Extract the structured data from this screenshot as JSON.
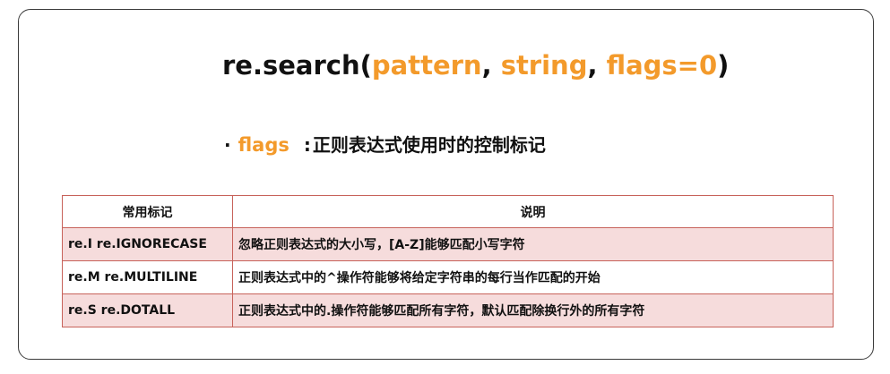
{
  "signature": {
    "func": "re.search",
    "open_paren": "(",
    "param1": "pattern",
    "comma1": ", ",
    "param2": "string",
    "comma2": ", ",
    "param3": "flags=0",
    "close_paren": ")"
  },
  "flags_line": {
    "bullet": "·",
    "keyword": "flags",
    "separator": ":",
    "description": "正则表达式使用时的控制标记"
  },
  "colors": {
    "accent": "#f39a2b",
    "row_shade": "#f6dcdc",
    "border": "#c7625a"
  },
  "table": {
    "headers": [
      "常用标记",
      "说明"
    ],
    "rows": [
      {
        "flag": "re.I  re.IGNORECASE",
        "desc": "忽略正则表达式的大小写，[A‐Z]能够匹配小写字符"
      },
      {
        "flag": "re.M  re.MULTILINE",
        "desc": "正则表达式中的^操作符能够将给定字符串的每行当作匹配的开始"
      },
      {
        "flag": "re.S  re.DOTALL",
        "desc": "正则表达式中的.操作符能够匹配所有字符，默认匹配除换行外的所有字符"
      }
    ]
  }
}
